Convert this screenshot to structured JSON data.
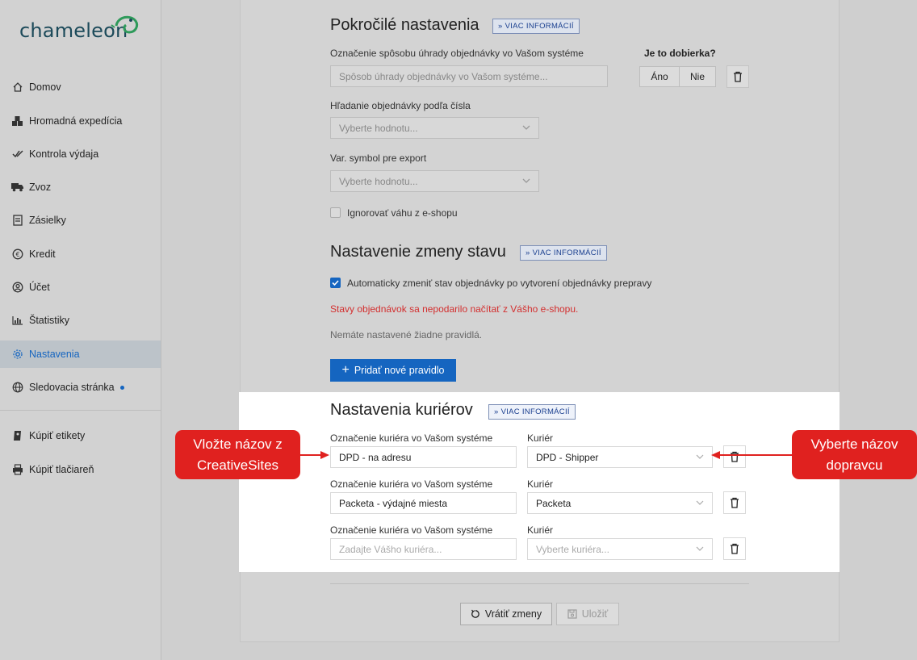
{
  "sidebar": {
    "logo": "chameleon",
    "items": [
      {
        "label": "Domov",
        "icon": "home-icon"
      },
      {
        "label": "Hromadná expedícia",
        "icon": "boxes-icon"
      },
      {
        "label": "Kontrola výdaja",
        "icon": "double-check-icon"
      },
      {
        "label": "Zvoz",
        "icon": "truck-icon"
      },
      {
        "label": "Zásielky",
        "icon": "list-icon"
      },
      {
        "label": "Kredit",
        "icon": "euro-icon"
      },
      {
        "label": "Účet",
        "icon": "user-circle-icon"
      },
      {
        "label": "Štatistiky",
        "icon": "bar-chart-icon"
      },
      {
        "label": "Nastavenia",
        "icon": "gear-icon",
        "active": true
      },
      {
        "label": "Sledovacia stránka",
        "icon": "globe-icon",
        "dot": true
      }
    ],
    "bottom_items": [
      {
        "label": "Kúpiť etikety",
        "icon": "label-icon"
      },
      {
        "label": "Kúpiť tlačiareň",
        "icon": "printer-icon"
      }
    ]
  },
  "advanced": {
    "title": "Pokročilé nastavenia",
    "info": "VIAC INFORMÁCIÍ",
    "payment_label": "Označenie spôsobu úhrady objednávky vo Vašom systéme",
    "payment_placeholder": "Spôsob úhrady objednávky vo Vašom systéme...",
    "cod_label": "Je to dobierka?",
    "cod_yes": "Áno",
    "cod_no": "Nie",
    "search_label": "Hľadanie objednávky podľa čísla",
    "search_placeholder": "Vyberte hodnotu...",
    "varsym_label": "Var. symbol pre export",
    "varsym_placeholder": "Vyberte hodnotu...",
    "ignore_weight_label": "Ignorovať váhu z e-shopu"
  },
  "status": {
    "title": "Nastavenie zmeny stavu",
    "info": "VIAC INFORMÁCIÍ",
    "auto_change_label": "Automaticky zmeniť stav objednávky po vytvorení objednávky prepravy",
    "error": "Stavy objednávok sa nepodarilo načítať z Vášho e-shopu.",
    "no_rules": "Nemáte nastavené žiadne pravidlá.",
    "add_rule": "Pridať nové pravidlo"
  },
  "couriers": {
    "title": "Nastavenia kuriérov",
    "info": "VIAC INFORMÁCIÍ",
    "name_label": "Označenie kuriéra vo Vašom systéme",
    "courier_label": "Kuriér",
    "rows": [
      {
        "name": "DPD - na adresu",
        "courier": "DPD - Shipper"
      },
      {
        "name": "Packeta - výdajné miesta",
        "courier": "Packeta"
      }
    ],
    "new_name_placeholder": "Zadajte Vášho kuriéra...",
    "new_courier_placeholder": "Vyberte kuriéra..."
  },
  "footer": {
    "revert": "Vrátiť zmeny",
    "save": "Uložiť"
  },
  "callouts": {
    "left_line1": "Vložte názov z",
    "left_line2": "CreativeSites",
    "right_line1": "Vyberte názov",
    "right_line2": "dopravcu"
  },
  "colors": {
    "accent": "#1565c0",
    "error": "#d32f2f",
    "callout": "#e0211f"
  }
}
